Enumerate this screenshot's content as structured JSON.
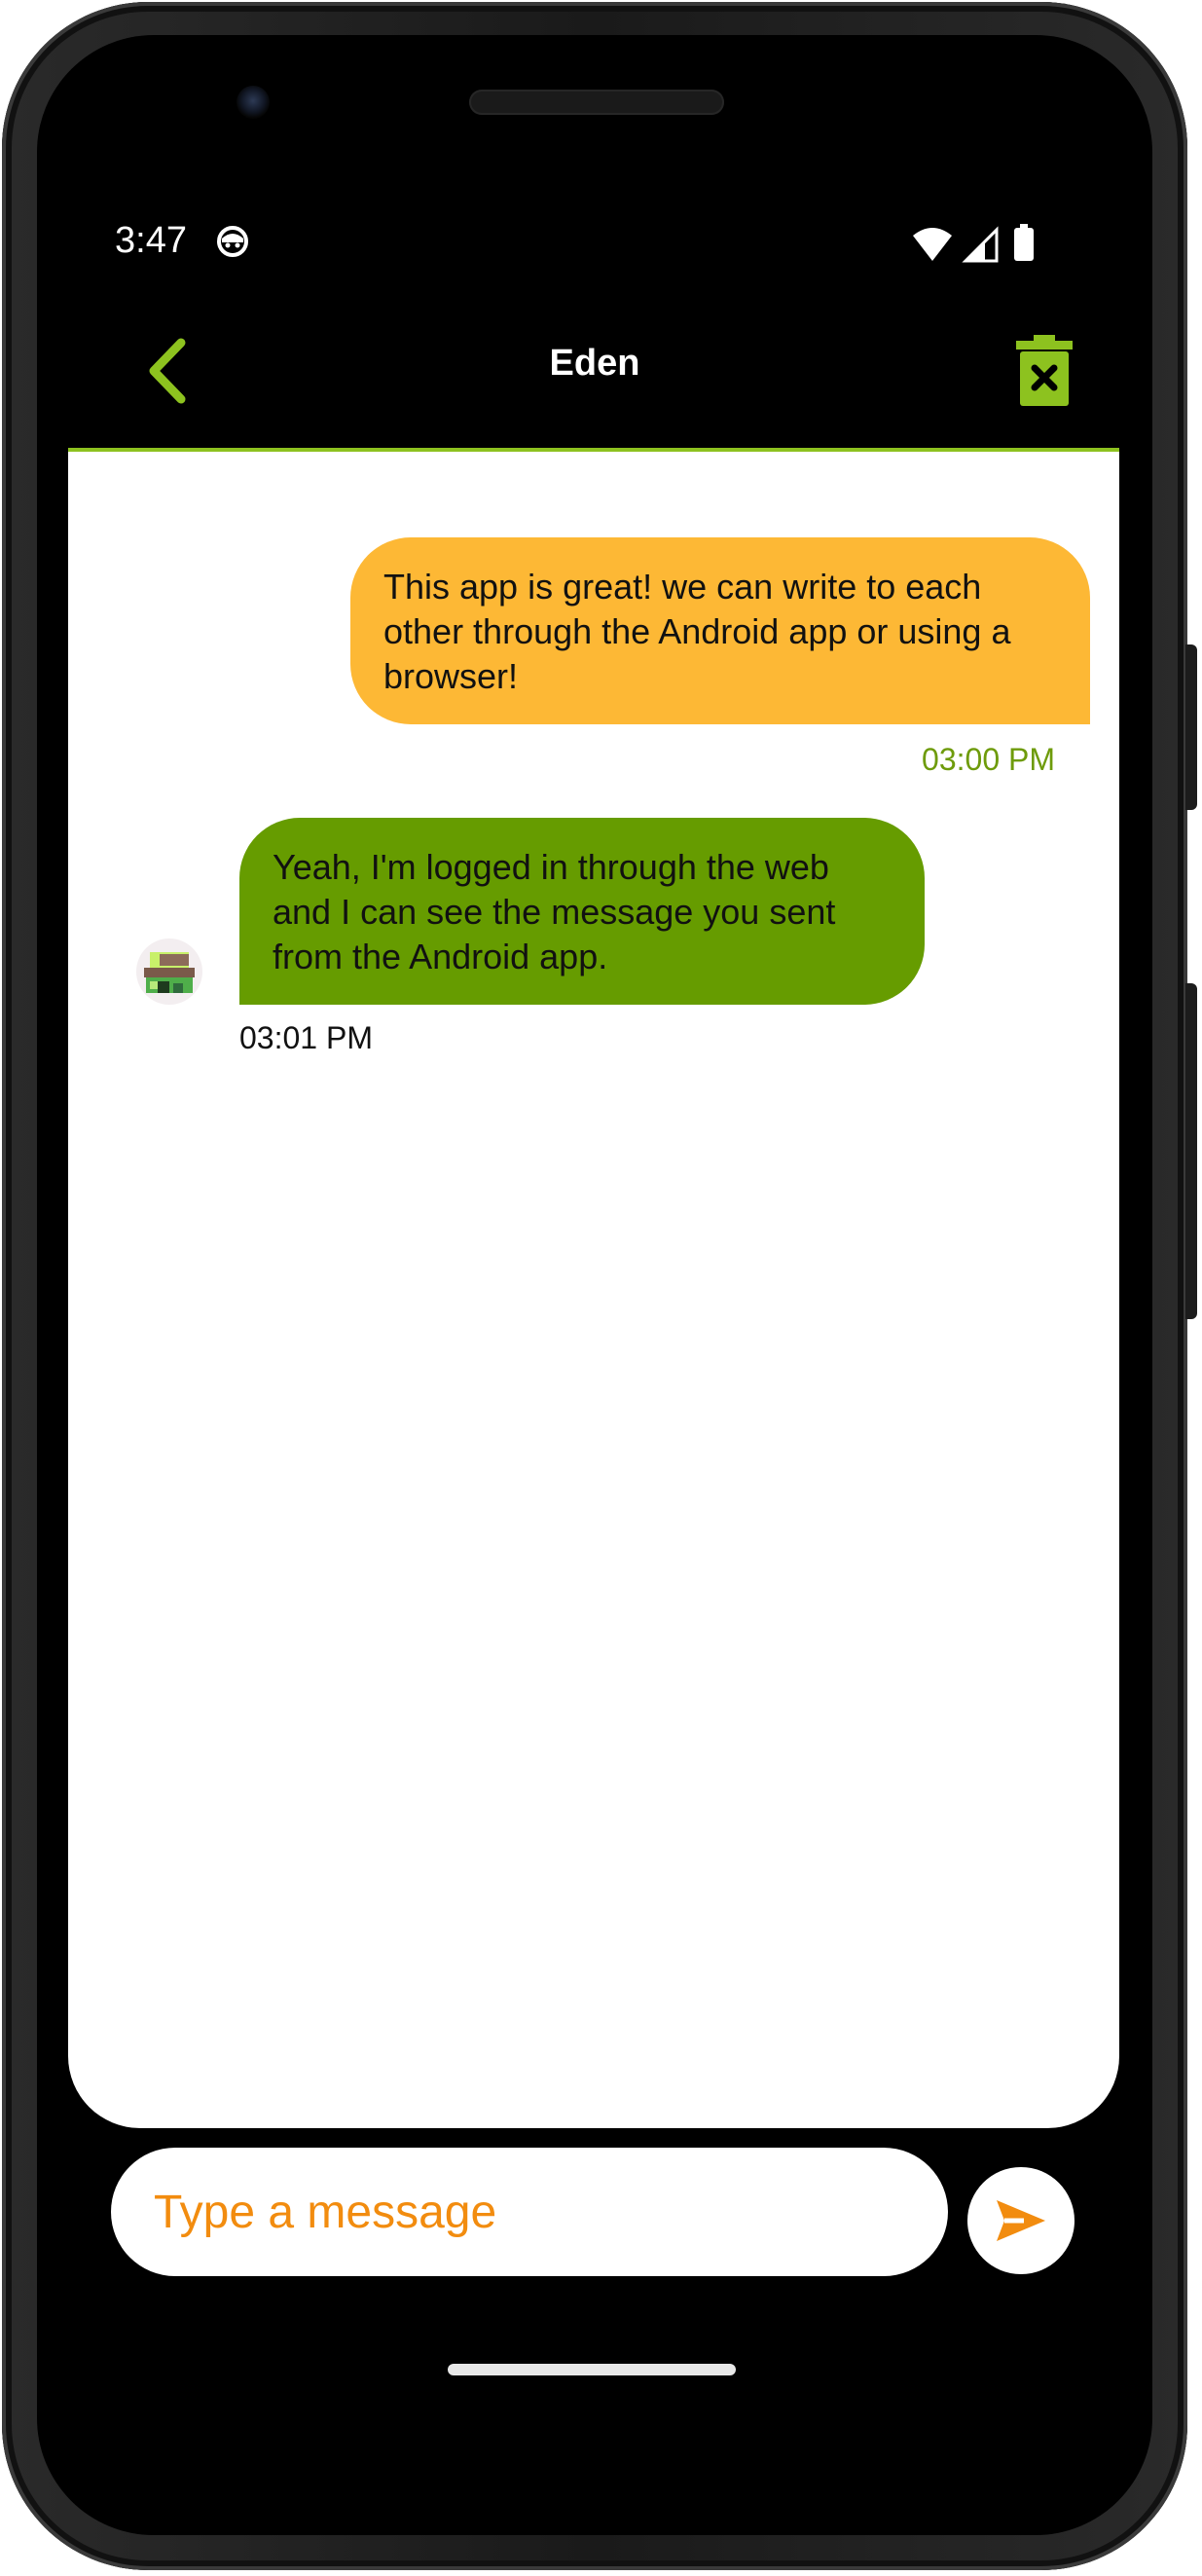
{
  "status_bar": {
    "time": "3:47",
    "icons": [
      "app-notification-icon",
      "wifi-icon",
      "cell-signal-icon",
      "battery-icon"
    ]
  },
  "app_bar": {
    "title": "Eden",
    "back_icon": "chevron-left-icon",
    "delete_icon": "trash-icon"
  },
  "messages": [
    {
      "direction": "outgoing",
      "text": "This app is great! we can write to each other through the Android app or using a browser!",
      "time": "03:00 PM"
    },
    {
      "direction": "incoming",
      "text": "Yeah, I'm logged in through the web and I can see the message you sent from the Android app.",
      "time": "03:01 PM"
    }
  ],
  "composer": {
    "placeholder": "Type a message",
    "send_icon": "send-icon"
  },
  "colors": {
    "accent_green": "#8dc21f",
    "outgoing_bubble": "#fdb835",
    "incoming_bubble": "#669c00",
    "outgoing_time": "#6e9b0b",
    "placeholder_orange": "#f28c0f",
    "background": "#000000"
  }
}
